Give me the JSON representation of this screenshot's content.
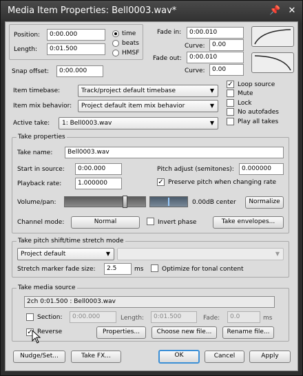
{
  "window": {
    "title": "Media Item Properties:  Bell0003.wav*",
    "pin_icon": "pin-icon",
    "close_icon": "close-icon"
  },
  "position": {
    "label": "Position:",
    "value": "0:00.000"
  },
  "length": {
    "label": "Length:",
    "value": "0:01.500"
  },
  "time_format": {
    "options": [
      "time",
      "beats",
      "HMSF"
    ],
    "selected": "time"
  },
  "fade_in": {
    "label": "Fade in:",
    "value": "0:00.010",
    "curve_label": "Curve:",
    "curve_value": "0.00"
  },
  "fade_out": {
    "label": "Fade out:",
    "value": "0:00.010",
    "curve_label": "Curve:",
    "curve_value": "0.00"
  },
  "snap_offset": {
    "label": "Snap offset:",
    "value": "0:00.000"
  },
  "item_timebase": {
    "label": "Item timebase:",
    "value": "Track/project default timebase"
  },
  "item_mix_behavior": {
    "label": "Item mix behavior:",
    "value": "Project default item mix behavior"
  },
  "active_take": {
    "label": "Active take:",
    "value": "1: Bell0003.wav"
  },
  "item_flags": [
    {
      "label": "Loop source",
      "checked": true
    },
    {
      "label": "Mute",
      "checked": false
    },
    {
      "label": "Lock",
      "checked": false
    },
    {
      "label": "No autofades",
      "checked": false
    },
    {
      "label": "Play all takes",
      "checked": false
    }
  ],
  "take_properties": {
    "title": "Take properties",
    "take_name_label": "Take name:",
    "take_name": "Bell0003.wav",
    "start_label": "Start in source:",
    "start_value": "0:00.000",
    "pitch_label": "Pitch adjust (semitones):",
    "pitch_value": "0.000000",
    "rate_label": "Playback rate:",
    "rate_value": "1.000000",
    "preserve_pitch_label": "Preserve pitch when changing rate",
    "preserve_pitch_checked": true,
    "volpan_label": "Volume/pan:",
    "volpan_readout": "0.00dB center",
    "normalize_label": "Normalize",
    "channel_label": "Channel mode:",
    "channel_value": "Normal",
    "invert_label": "Invert phase",
    "invert_checked": false,
    "envelopes_label": "Take envelopes..."
  },
  "pitch_shift": {
    "title": "Take pitch shift/time stretch mode",
    "mode": "Project default",
    "submode": "",
    "fade_label": "Stretch marker fade size:",
    "fade_value": "2.5",
    "fade_unit": "ms",
    "optimize_label": "Optimize for tonal content",
    "optimize_checked": false
  },
  "media_source": {
    "title": "Take media source",
    "info": "2ch 0:01.500 : Bell0003.wav",
    "section_label": "Section:",
    "section_value": "0:00.000",
    "length_label": "Length:",
    "length_value": "0:01.500",
    "fade_label": "Fade:",
    "fade_value": "0.0",
    "fade_unit": "ms",
    "reverse_label": "Reverse",
    "reverse_checked": true,
    "properties_label": "Properties...",
    "choose_label": "Choose new file...",
    "rename_label": "Rename file..."
  },
  "footer": {
    "nudge": "Nudge/Set...",
    "take_fx": "Take FX...",
    "ok": "OK",
    "cancel": "Cancel",
    "apply": "Apply"
  },
  "volume_level": 0.76,
  "pan_level": 0.5
}
